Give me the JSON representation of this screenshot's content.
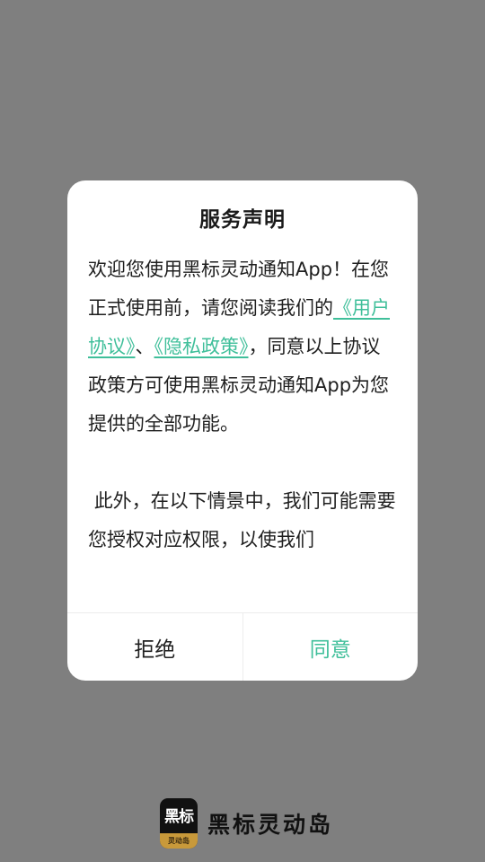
{
  "dialog": {
    "title": "服务声明",
    "body": {
      "intro": "欢迎您使用黑标灵动通知App！在您正式使用前，请您阅读我们的",
      "user_agreement": "《用户协议》",
      "separator": "、",
      "privacy_policy": "《隐私政策》",
      "after_links": "，同意以上协议政策方可使用黑标灵动通知App为您提供的全部功能。",
      "paragraph2": " 此外，在以下情景中，我们可能需要您授权对应权限，以使我们"
    },
    "buttons": {
      "reject": "拒绝",
      "agree": "同意"
    }
  },
  "brand": {
    "icon_text": "黑标",
    "icon_band": "灵动岛",
    "name": "黑标灵动岛"
  },
  "colors": {
    "accent": "#3fbf9a",
    "overlay": "#7f7f7f"
  }
}
